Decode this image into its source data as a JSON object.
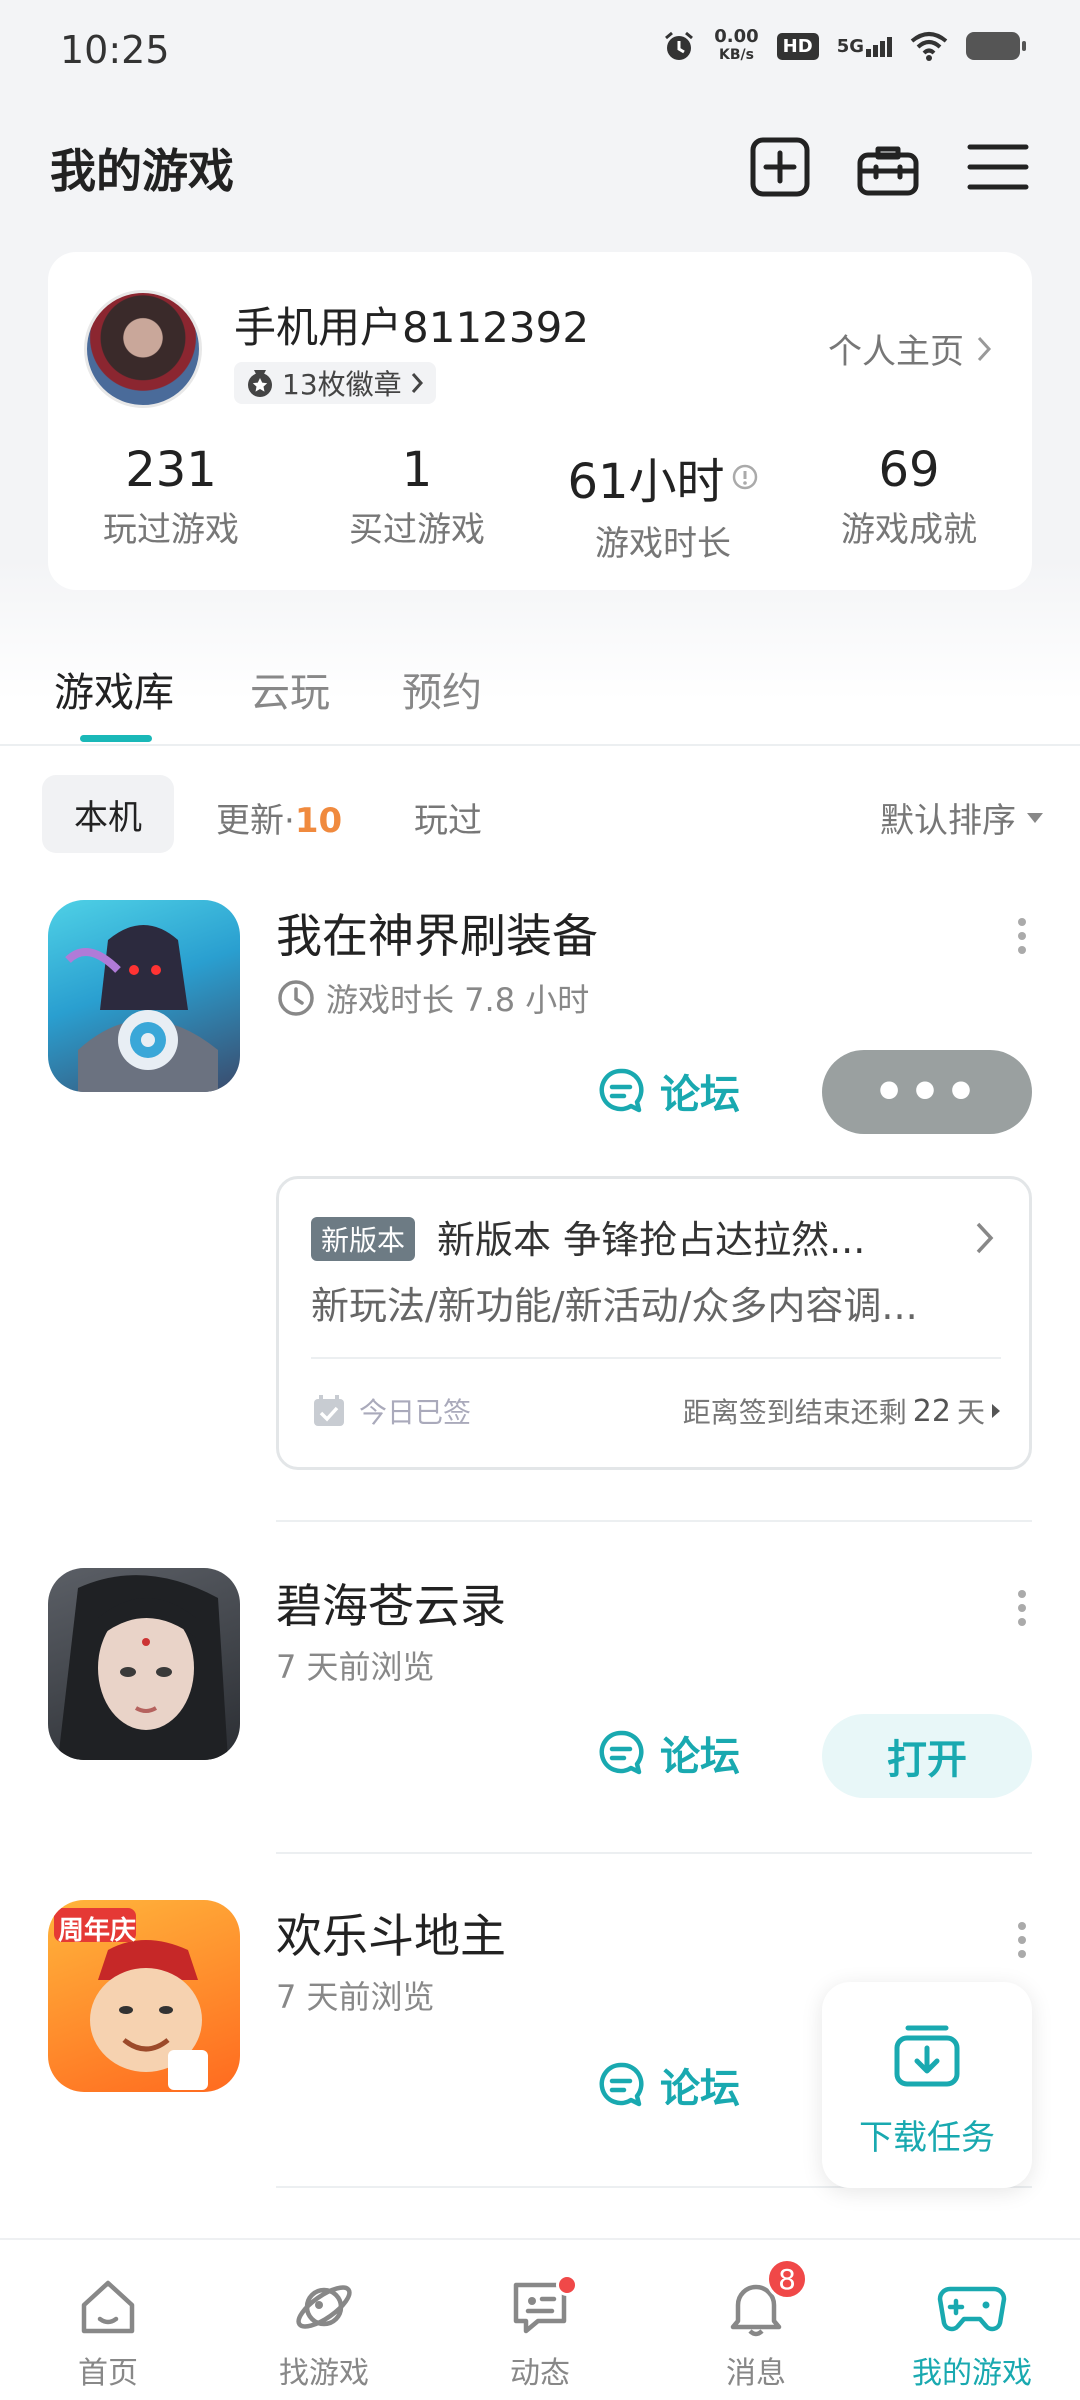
{
  "status_bar": {
    "time": "10:25",
    "net_speed_value": "0.00",
    "net_speed_unit": "KB/s",
    "hd": "HD",
    "network": "5G"
  },
  "header": {
    "title": "我的游戏",
    "icons": [
      "add-square-icon",
      "toolbox-icon",
      "menu-icon"
    ]
  },
  "profile": {
    "username": "手机用户8112392",
    "badges": "13枚徽章",
    "homepage_link": "个人主页",
    "stats": [
      {
        "value": "231",
        "label": "玩过游戏"
      },
      {
        "value": "1",
        "label": "买过游戏"
      },
      {
        "value": "61小时",
        "label": "游戏时长"
      },
      {
        "value": "69",
        "label": "游戏成就"
      }
    ]
  },
  "tabs": [
    {
      "label": "游戏库",
      "active": true
    },
    {
      "label": "云玩",
      "active": false
    },
    {
      "label": "预约",
      "active": false
    }
  ],
  "filters": {
    "local": "本机",
    "update_label": "更新·",
    "update_count": "10",
    "played": "玩过",
    "sort": "默认排序"
  },
  "games": [
    {
      "name": "我在神界刷装备",
      "subtitle": "游戏时长 7.8 小时",
      "forum": "论坛",
      "action": "•••",
      "update": {
        "tag": "新版本",
        "title": "新版本 争锋抢占达拉然...",
        "desc": "新玩法/新功能/新活动/众多内容调...",
        "signed": "今日已签",
        "days_left_prefix": "距离签到结束还剩",
        "days_left_value": "22",
        "days_left_suffix": "天"
      }
    },
    {
      "name": "碧海苍云录",
      "subtitle": "7 天前浏览",
      "forum": "论坛",
      "action": "打开"
    },
    {
      "name": "欢乐斗地主",
      "subtitle": "7 天前浏览",
      "forum": "论坛",
      "icon_tag": "周年庆"
    }
  ],
  "download_task": {
    "label": "下载任务"
  },
  "bottom_nav": [
    {
      "label": "首页",
      "icon": "home-icon"
    },
    {
      "label": "找游戏",
      "icon": "planet-icon"
    },
    {
      "label": "动态",
      "icon": "chat-icon",
      "dot": true
    },
    {
      "label": "消息",
      "icon": "bell-icon",
      "badge": "8"
    },
    {
      "label": "我的游戏",
      "icon": "gamepad-icon",
      "active": true
    }
  ],
  "colors": {
    "accent": "#19a9b0",
    "update_count": "#f08a3e",
    "badge_red": "#f04848"
  }
}
